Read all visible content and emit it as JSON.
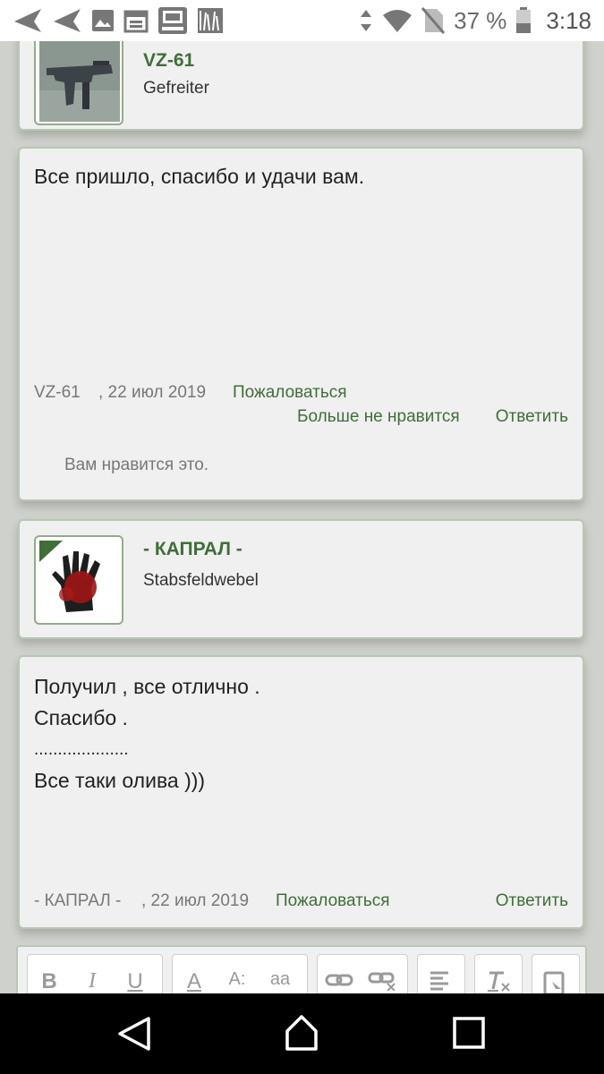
{
  "status_bar": {
    "battery": "37 %",
    "time": "3:18",
    "icons": [
      "send-icon",
      "send-icon",
      "image-icon",
      "calendar-icon",
      "radio-icon",
      "chart-icon",
      "vibrate-icon",
      "wifi-icon",
      "no-sim-icon",
      "battery-icon"
    ]
  },
  "post1": {
    "author": "VZ-61",
    "rank": "Gefreiter",
    "text": [
      "Все пришло, спасибо и удачи вам."
    ],
    "meta_author": "VZ-61",
    "date": ", 22 июл 2019",
    "report": "Пожаловаться",
    "unlike": "Больше не нравится",
    "reply": "Ответить",
    "likes_note": "Вам нравится это."
  },
  "post2": {
    "author": "- КАПРАЛ -",
    "rank": "Stabsfeldwebel",
    "text": [
      "Получил , все отлично .",
      "Спасибо .",
      "....................",
      "Все таки олива )))"
    ],
    "meta_author": "- КАПРАЛ -",
    "date": ", 22 июл 2019",
    "report": "Пожаловаться",
    "reply": "Ответить"
  },
  "editor": {
    "buttons": [
      "B",
      "I",
      "U",
      "A",
      "A:",
      "aa"
    ]
  },
  "colors": {
    "accent": "#3f6e38",
    "background": "#cfd1cc",
    "card": "#f0f0f0"
  }
}
